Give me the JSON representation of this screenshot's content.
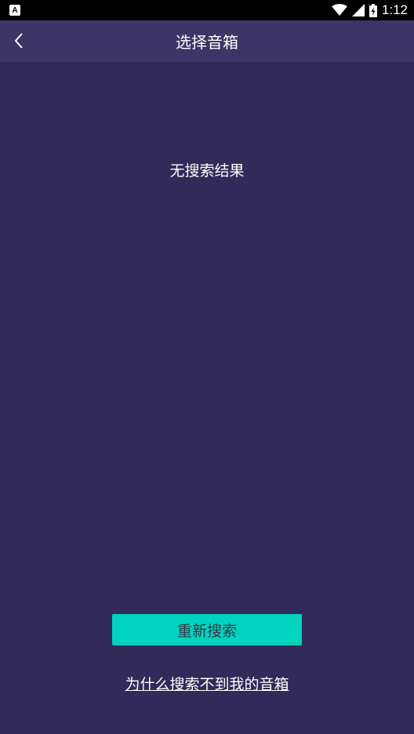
{
  "status_bar": {
    "notification_icon": "A",
    "time": "1:12",
    "icons": [
      "wifi-icon",
      "signal-icon",
      "battery-charging-icon"
    ]
  },
  "app_bar": {
    "title": "选择音箱",
    "back_icon": "chevron-left-icon"
  },
  "content": {
    "empty_text": "无搜索结果"
  },
  "actions": {
    "research_label": "重新搜索",
    "help_link": "为什么搜索不到我的音箱"
  },
  "colors": {
    "background": "#322a58",
    "app_bar": "#3d3565",
    "accent": "#00d4bf",
    "button_text": "#2e3a4a",
    "text": "#ffffff"
  }
}
